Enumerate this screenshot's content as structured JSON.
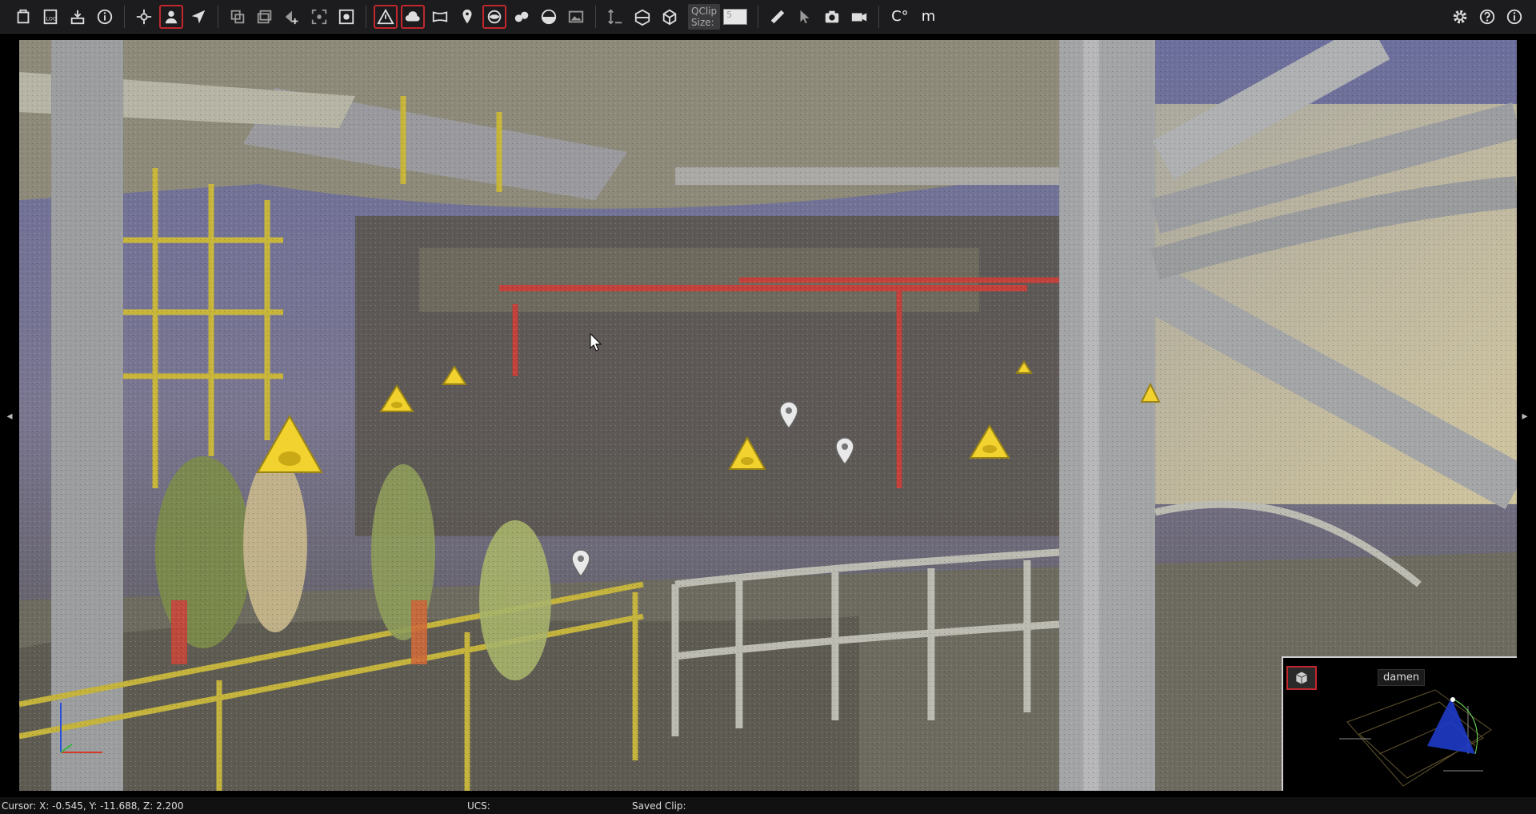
{
  "toolbar": {
    "qclip_label_line1": "QClip",
    "qclip_label_line2": "Size:",
    "qclip_value": "5",
    "unit_degree": "C°",
    "unit_length": "m"
  },
  "viewport": {
    "left_arrow": "◂",
    "right_arrow": "▸"
  },
  "minimap": {
    "label": "damen"
  },
  "status": {
    "cursor": "Cursor: X: -0.545, Y: -11.688, Z: 2.200",
    "ucs": "UCS:",
    "saved_clip": "Saved Clip:"
  },
  "colors": {
    "accent_active": "#c1272d",
    "warning_yellow": "#f2d22e",
    "toolbar_bg": "#1c1c1e"
  }
}
